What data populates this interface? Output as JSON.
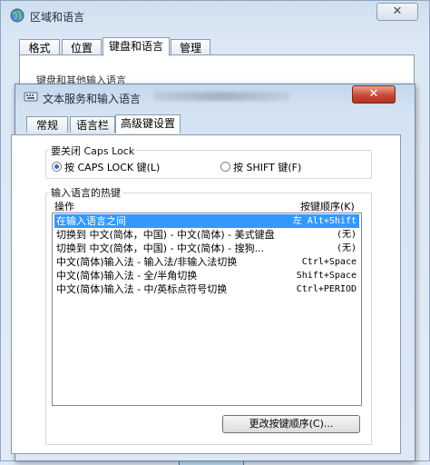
{
  "outer": {
    "title": "区域和语言",
    "close_label": "✕",
    "tabs": [
      "格式",
      "位置",
      "键盘和语言",
      "管理"
    ],
    "group_label": "键盘和其他输入语言"
  },
  "dialog": {
    "title": "文本服务和输入语言",
    "close_label": "✕",
    "tabs": [
      "常规",
      "语言栏",
      "高级键设置"
    ],
    "caps_group_label": "要关闭 Caps Lock",
    "radio_caps": "按 CAPS LOCK 键(L)",
    "radio_shift": "按 SHIFT 键(F)",
    "hotkey_group_label": "输入语言的热键",
    "col_action": "操作",
    "col_keys": "按键顺序(K)",
    "rows": [
      {
        "action": "在输入语言之间",
        "keys": "左 Alt+Shift"
      },
      {
        "action": "切换到 中文(简体，中国) - 中文(简体) - 美式键盘",
        "keys": "(无)"
      },
      {
        "action": "切换到 中文(简体，中国) - 中文(简体) - 搜狗...",
        "keys": "(无)"
      },
      {
        "action": "中文(简体)输入法 - 输入法/非输入法切换",
        "keys": "Ctrl+Space"
      },
      {
        "action": "中文(简体)输入法 - 全/半角切换",
        "keys": "Shift+Space"
      },
      {
        "action": "中文(简体)输入法 - 中/英标点符号切换",
        "keys": "Ctrl+PERIOD"
      }
    ],
    "change_button": "更改按键顺序(C)..."
  }
}
